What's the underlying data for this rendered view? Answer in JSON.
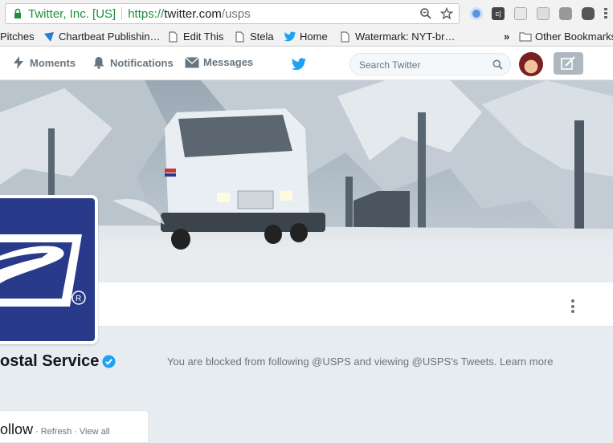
{
  "browser": {
    "security_label": "Twitter, Inc. [US]",
    "url_scheme": "https://",
    "url_host": "twitter.com",
    "url_path": "/usps",
    "bookmarks": [
      {
        "label": "Pitches",
        "icon": "none"
      },
      {
        "label": "Chartbeat Publishin…",
        "icon": "chartbeat-icon"
      },
      {
        "label": "Edit This",
        "icon": "page-icon"
      },
      {
        "label": "Stela",
        "icon": "page-icon"
      },
      {
        "label": "Home",
        "icon": "twitter-bird-icon"
      },
      {
        "label": "Watermark: NYT-br…",
        "icon": "page-icon"
      }
    ],
    "overflow_label": "»",
    "other_bookmarks": "Other Bookmarks"
  },
  "twitter_nav": {
    "moments": "Moments",
    "notifications": "Notifications",
    "messages": "Messages",
    "search_placeholder": "Search Twitter",
    "brand_color": "#1da1f2"
  },
  "profile": {
    "name_partial": "ostal Service",
    "verified": true,
    "blocked_message": "You are blocked from following @USPS and viewing @USPS's Tweets. Learn more",
    "who_to_follow": "ollow",
    "refresh": "Refresh",
    "view_all": "View all",
    "separator": "·",
    "logo_color": "#2a3a8a"
  }
}
